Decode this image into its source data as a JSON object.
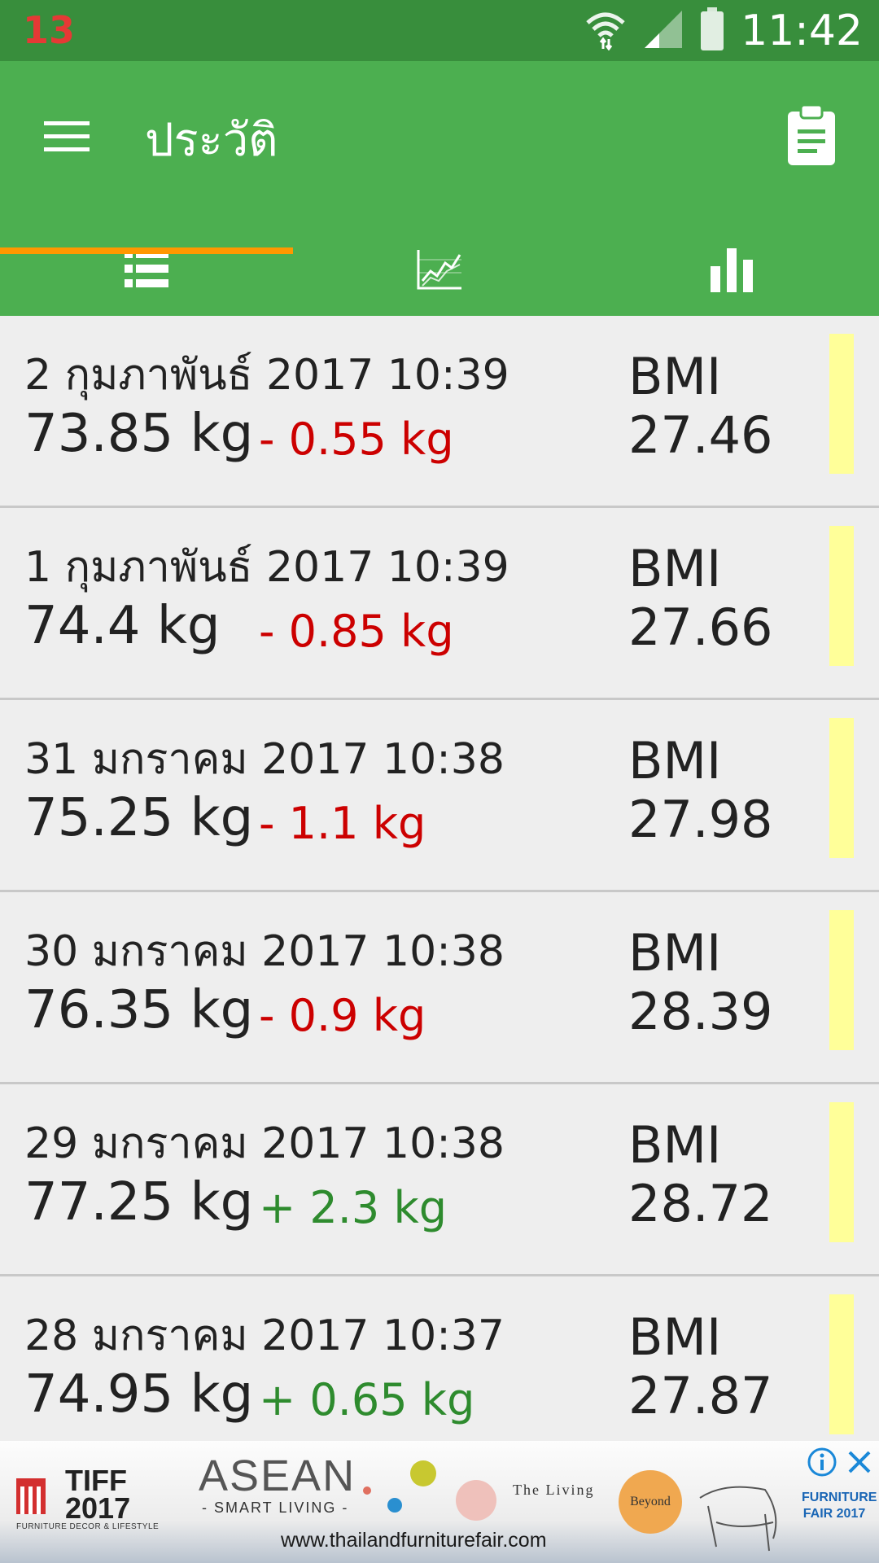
{
  "status_bar": {
    "notification_count": "13",
    "time": "11:42",
    "icons": [
      "wifi-icon",
      "signal-icon",
      "battery-icon"
    ]
  },
  "app_bar": {
    "title": "ประวัติ",
    "menu_icon": "menu-icon",
    "action_icon": "clipboard-icon"
  },
  "tabs": [
    {
      "name": "list-tab",
      "icon": "list-icon",
      "selected": true
    },
    {
      "name": "chart-tab",
      "icon": "line-chart-icon",
      "selected": false
    },
    {
      "name": "stats-tab",
      "icon": "bar-chart-icon",
      "selected": false
    }
  ],
  "entries": [
    {
      "date": "2 กุมภาพันธ์ 2017 10:39",
      "weight": "73.85 kg",
      "change": "- 0.55 kg",
      "direction": "down",
      "bmi_label": "BMI",
      "bmi": "27.46"
    },
    {
      "date": "1 กุมภาพันธ์ 2017 10:39",
      "weight": "74.4 kg",
      "change": "- 0.85 kg",
      "direction": "down",
      "bmi_label": "BMI",
      "bmi": "27.66"
    },
    {
      "date": "31 มกราคม 2017 10:38",
      "weight": "75.25 kg",
      "change": "- 1.1 kg",
      "direction": "down",
      "bmi_label": "BMI",
      "bmi": "27.98"
    },
    {
      "date": "30 มกราคม 2017 10:38",
      "weight": "76.35 kg",
      "change": "- 0.9 kg",
      "direction": "down",
      "bmi_label": "BMI",
      "bmi": "28.39"
    },
    {
      "date": "29 มกราคม 2017 10:38",
      "weight": "77.25 kg",
      "change": "+ 2.3 kg",
      "direction": "up",
      "bmi_label": "BMI",
      "bmi": "28.72"
    },
    {
      "date": "28 มกราคม 2017 10:37",
      "weight": "74.95 kg",
      "change": "+ 0.65 kg",
      "direction": "up",
      "bmi_label": "BMI",
      "bmi": "27.87"
    }
  ],
  "colors": {
    "status_bar": "#388e3c",
    "app_bar": "#4caf50",
    "tab_indicator": "#ff9800",
    "weight_down": "#cc0000",
    "weight_up": "#2e8b2e",
    "bmi_indicator": "#ffff99",
    "list_background": "#eeeeee"
  },
  "ad": {
    "brand": "TIFF\n2017",
    "brand_sub": "FURNITURE DECOR & LIFESTYLE",
    "headline": "ASEAN",
    "subheadline": "- SMART LIVING -",
    "tagline": "The Living",
    "tagline_circle": "Beyond",
    "url": "www.thailandfurniturefair.com",
    "fair_label": "FURNITURE FAIR 2017"
  }
}
